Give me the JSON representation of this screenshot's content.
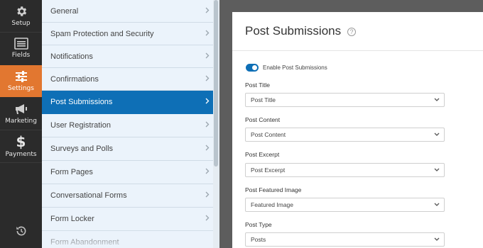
{
  "rail": {
    "items": [
      {
        "label": "Setup",
        "icon": "gear-icon"
      },
      {
        "label": "Fields",
        "icon": "fields-list-icon"
      },
      {
        "label": "Settings",
        "icon": "sliders-icon",
        "active": true
      },
      {
        "label": "Marketing",
        "icon": "megaphone-icon"
      },
      {
        "label": "Payments",
        "icon": "dollar-icon"
      }
    ],
    "footer_icon": "history-icon"
  },
  "menu": {
    "items": [
      {
        "label": "General"
      },
      {
        "label": "Spam Protection and Security"
      },
      {
        "label": "Notifications"
      },
      {
        "label": "Confirmations"
      },
      {
        "label": "Post Submissions",
        "active": true
      },
      {
        "label": "User Registration"
      },
      {
        "label": "Surveys and Polls"
      },
      {
        "label": "Form Pages"
      },
      {
        "label": "Conversational Forms"
      },
      {
        "label": "Form Locker"
      },
      {
        "label": "Form Abandonment"
      }
    ]
  },
  "main": {
    "title": "Post Submissions",
    "help_glyph": "?",
    "enable_toggle": {
      "label": "Enable Post Submissions",
      "on": true
    },
    "fields": [
      {
        "label": "Post Title",
        "value": "Post Title"
      },
      {
        "label": "Post Content",
        "value": "Post Content"
      },
      {
        "label": "Post Excerpt",
        "value": "Post Excerpt"
      },
      {
        "label": "Post Featured Image",
        "value": "Featured Image"
      },
      {
        "label": "Post Type",
        "value": "Posts"
      }
    ]
  },
  "colors": {
    "accent_orange": "#e27730",
    "active_blue": "#0e6fb6",
    "rail_bg": "#2b2b2b",
    "menu_bg": "#ebf3fb"
  }
}
